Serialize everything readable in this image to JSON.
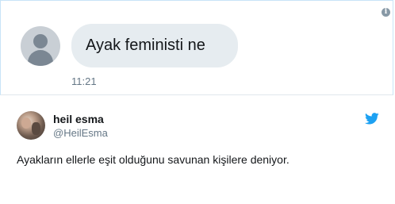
{
  "dm": {
    "message": "Ayak feministi ne",
    "time": "11:21",
    "info_icon": "info-icon",
    "avatar_icon": "default-avatar-icon"
  },
  "tweet": {
    "display_name": "heil esma",
    "handle": "@HeilEsma",
    "text": "Ayakların ellerle eşit olduğunu savunan kişilere deniyor.",
    "platform_icon": "twitter-bird-icon",
    "brand_color": "#1da1f2"
  }
}
